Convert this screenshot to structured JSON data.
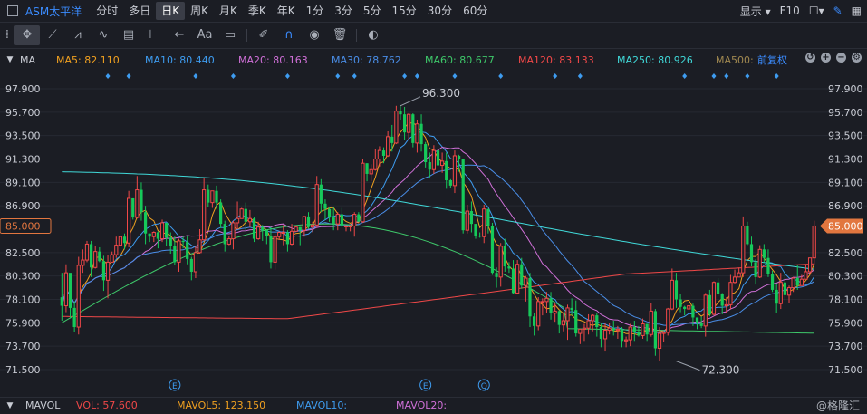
{
  "topbar": {
    "symbol": "ASM太平洋",
    "periods": [
      "分时",
      "多日",
      "日K",
      "周K",
      "月K",
      "季K",
      "年K",
      "1分",
      "3分",
      "5分",
      "15分",
      "30分",
      "60分"
    ],
    "active_period": "日K",
    "display_label": "显示",
    "f10_label": "F10"
  },
  "toolbar": {
    "text_tool": "Aa"
  },
  "legend": {
    "title": "MA",
    "items": [
      {
        "text": "MA5: 82.110",
        "color": "#f0a020"
      },
      {
        "text": "MA10: 80.440",
        "color": "#3e9cf0"
      },
      {
        "text": "MA20: 80.163",
        "color": "#d070d8"
      },
      {
        "text": "MA30: 78.762",
        "color": "#4a8ee8"
      },
      {
        "text": "MA60: 80.677",
        "color": "#3ec86a"
      },
      {
        "text": "MA120: 83.133",
        "color": "#f04848"
      },
      {
        "text": "MA250: 80.926",
        "color": "#40d8d8"
      },
      {
        "text": "MA500: ",
        "color": "#a08850"
      }
    ],
    "adjust_label": "前复权"
  },
  "bottom": {
    "title": "MAVOL",
    "items": [
      {
        "text": "VOL: 57.600",
        "color": "#f04848"
      },
      {
        "text": "MAVOL5: 123.150",
        "color": "#f0a020"
      },
      {
        "text": "MAVOL10: ",
        "color": "#3e9cf0"
      },
      {
        "text": "MAVOL20: ",
        "color": "#d070d8"
      }
    ],
    "watermark": "@格隆汇"
  },
  "chart_data": {
    "type": "candlestick",
    "y_ticks": [
      "97.900",
      "95.700",
      "93.500",
      "91.300",
      "89.100",
      "86.900",
      "85.000",
      "82.500",
      "80.300",
      "78.100",
      "75.900",
      "73.700",
      "71.500"
    ],
    "y_tick_values": [
      97.9,
      95.7,
      93.5,
      91.3,
      89.1,
      86.9,
      85.0,
      82.5,
      80.3,
      78.1,
      75.9,
      73.7,
      71.5
    ],
    "current_price_label": "85.000",
    "current_price": 85.0,
    "high_annotation": {
      "label": "96.300",
      "value": 96.3,
      "index": 81
    },
    "low_annotation": {
      "label": "72.300",
      "value": 72.3,
      "index": 147
    },
    "event_markers": [
      {
        "label": "E",
        "index": 27
      },
      {
        "label": "E",
        "index": 87
      },
      {
        "label": "Q",
        "index": 101
      }
    ],
    "colors": {
      "up": "#f04848",
      "down": "#16c95a",
      "price_line": "#e2763f"
    },
    "candles": [
      [
        78.3,
        77.5,
        80.6,
        76.1
      ],
      [
        77.5,
        80.6,
        81.4,
        76.9
      ],
      [
        80.6,
        77.3,
        80.3,
        76.3
      ],
      [
        77.3,
        75.5,
        77.9,
        75.0
      ],
      [
        75.5,
        81.3,
        82.1,
        74.8
      ],
      [
        81.3,
        81.8,
        82.8,
        80.6
      ],
      [
        81.8,
        83.3,
        83.6,
        81.6
      ],
      [
        83.3,
        81.1,
        83.6,
        80.2
      ],
      [
        81.1,
        82.6,
        83.1,
        81.0
      ],
      [
        82.6,
        81.7,
        83.0,
        81.6
      ],
      [
        81.7,
        79.9,
        82.2,
        78.9
      ],
      [
        79.9,
        81.6,
        82.3,
        78.2
      ],
      [
        81.6,
        82.3,
        82.6,
        81.6
      ],
      [
        82.3,
        83.2,
        84.0,
        82.0
      ],
      [
        83.2,
        84.0,
        84.1,
        83.1
      ],
      [
        84.0,
        83.4,
        84.3,
        82.8
      ],
      [
        83.4,
        87.6,
        88.3,
        83.0
      ],
      [
        87.6,
        85.8,
        87.6,
        85.6
      ],
      [
        85.8,
        88.4,
        89.7,
        85.7
      ],
      [
        88.4,
        86.3,
        89.1,
        85.5
      ],
      [
        86.3,
        84.3,
        86.9,
        83.3
      ],
      [
        84.3,
        84.0,
        84.3,
        83.5
      ],
      [
        84.0,
        84.4,
        84.5,
        83.5
      ],
      [
        84.4,
        83.8,
        84.5,
        82.9
      ],
      [
        83.8,
        85.3,
        85.6,
        83.5
      ],
      [
        85.3,
        83.9,
        85.3,
        83.1
      ],
      [
        83.9,
        83.1,
        84.4,
        82.4
      ],
      [
        83.1,
        81.6,
        84.0,
        81.3
      ],
      [
        81.6,
        83.6,
        83.8,
        80.7
      ],
      [
        83.6,
        83.5,
        84.0,
        82.9
      ],
      [
        83.5,
        81.9,
        84.1,
        81.4
      ],
      [
        81.9,
        80.7,
        82.1,
        79.9
      ],
      [
        80.7,
        82.5,
        83.1,
        80.1
      ],
      [
        82.5,
        83.7,
        84.7,
        82.4
      ],
      [
        83.7,
        88.4,
        89.5,
        83.6
      ],
      [
        88.4,
        87.2,
        88.9,
        86.8
      ],
      [
        87.2,
        88.3,
        88.3,
        86.7
      ],
      [
        88.3,
        87.2,
        88.8,
        86.6
      ],
      [
        87.2,
        85.2,
        87.5,
        84.8
      ],
      [
        85.2,
        83.3,
        85.5,
        82.6
      ],
      [
        83.3,
        83.8,
        84.1,
        83.2
      ],
      [
        83.8,
        85.3,
        85.5,
        82.8
      ],
      [
        85.3,
        85.7,
        87.3,
        84.7
      ],
      [
        85.7,
        86.6,
        86.7,
        85.7
      ],
      [
        86.6,
        85.4,
        87.2,
        84.6
      ],
      [
        85.4,
        85.7,
        86.5,
        84.9
      ],
      [
        85.7,
        83.8,
        85.8,
        83.5
      ],
      [
        83.8,
        84.9,
        85.4,
        83.7
      ],
      [
        84.9,
        84.6,
        85.1,
        83.6
      ],
      [
        84.6,
        84.1,
        84.7,
        83.3
      ],
      [
        84.1,
        81.6,
        84.9,
        81.0
      ],
      [
        81.6,
        84.0,
        84.3,
        80.9
      ],
      [
        84.0,
        84.4,
        84.5,
        83.7
      ],
      [
        84.4,
        84.4,
        85.1,
        83.2
      ],
      [
        84.4,
        83.3,
        84.6,
        82.6
      ],
      [
        83.3,
        84.5,
        85.2,
        83.2
      ],
      [
        84.5,
        84.9,
        85.0,
        84.8
      ],
      [
        84.9,
        84.6,
        84.9,
        83.2
      ],
      [
        84.6,
        85.9,
        85.9,
        84.0
      ],
      [
        85.9,
        84.9,
        86.3,
        84.7
      ],
      [
        84.9,
        85.1,
        85.4,
        84.4
      ],
      [
        85.1,
        88.9,
        89.7,
        84.9
      ],
      [
        88.9,
        87.1,
        89.4,
        86.3
      ],
      [
        87.1,
        86.6,
        87.5,
        85.6
      ],
      [
        86.6,
        85.8,
        86.8,
        85.4
      ],
      [
        85.8,
        85.2,
        86.8,
        84.6
      ],
      [
        85.2,
        86.1,
        86.3,
        84.6
      ],
      [
        86.1,
        85.0,
        86.7,
        84.9
      ],
      [
        85.0,
        85.0,
        85.0,
        84.5
      ],
      [
        85.0,
        85.0,
        85.1,
        84.5
      ],
      [
        85.0,
        86.1,
        86.3,
        84.0
      ],
      [
        86.1,
        85.4,
        86.3,
        85.4
      ],
      [
        85.4,
        90.9,
        91.3,
        85.3
      ],
      [
        90.9,
        89.9,
        90.9,
        89.2
      ],
      [
        89.9,
        90.3,
        90.8,
        89.2
      ],
      [
        90.3,
        91.3,
        92.2,
        90.2
      ],
      [
        91.3,
        92.1,
        92.5,
        90.6
      ],
      [
        92.1,
        91.6,
        92.4,
        90.9
      ],
      [
        91.6,
        93.4,
        93.9,
        91.5
      ],
      [
        93.4,
        92.8,
        94.5,
        92.0
      ],
      [
        92.8,
        95.8,
        96.3,
        92.7
      ],
      [
        95.8,
        95.5,
        96.3,
        95.0
      ],
      [
        95.5,
        93.8,
        96.2,
        93.1
      ],
      [
        93.8,
        95.5,
        95.6,
        93.1
      ],
      [
        95.5,
        92.8,
        95.6,
        92.4
      ],
      [
        92.8,
        94.6,
        95.0,
        91.9
      ],
      [
        94.6,
        92.7,
        95.5,
        92.0
      ],
      [
        92.7,
        91.0,
        92.9,
        90.5
      ],
      [
        91.0,
        90.3,
        91.9,
        89.5
      ],
      [
        90.3,
        92.1,
        92.6,
        89.9
      ],
      [
        92.1,
        90.7,
        92.6,
        89.9
      ],
      [
        90.7,
        91.1,
        91.9,
        90.0
      ],
      [
        91.1,
        89.3,
        91.9,
        88.5
      ],
      [
        89.3,
        88.8,
        89.4,
        88.6
      ],
      [
        88.8,
        91.6,
        92.1,
        88.1
      ],
      [
        91.6,
        91.3,
        91.7,
        90.1
      ],
      [
        91.3,
        84.6,
        91.3,
        84.3
      ],
      [
        84.6,
        86.4,
        87.0,
        84.3
      ],
      [
        86.4,
        85.2,
        87.3,
        84.4
      ],
      [
        85.2,
        84.1,
        85.2,
        83.8
      ],
      [
        84.1,
        84.0,
        84.4,
        83.9
      ],
      [
        84.0,
        86.6,
        87.0,
        83.4
      ],
      [
        86.6,
        85.0,
        86.6,
        84.3
      ],
      [
        85.0,
        80.6,
        85.3,
        80.4
      ],
      [
        80.6,
        80.2,
        81.1,
        79.2
      ],
      [
        80.2,
        83.1,
        83.4,
        79.3
      ],
      [
        83.1,
        81.2,
        83.8,
        80.7
      ],
      [
        81.2,
        81.0,
        81.6,
        80.6
      ],
      [
        81.0,
        78.7,
        81.8,
        78.6
      ],
      [
        78.7,
        81.4,
        81.8,
        78.6
      ],
      [
        81.4,
        79.4,
        82.0,
        79.1
      ],
      [
        79.4,
        80.1,
        80.3,
        77.9
      ],
      [
        80.1,
        76.5,
        80.6,
        75.5
      ],
      [
        76.5,
        75.6,
        76.8,
        74.7
      ],
      [
        75.6,
        77.9,
        78.3,
        75.2
      ],
      [
        77.9,
        77.9,
        78.2,
        76.6
      ],
      [
        77.9,
        78.2,
        78.8,
        76.8
      ],
      [
        78.2,
        76.8,
        78.8,
        76.2
      ],
      [
        76.8,
        77.0,
        77.8,
        76.0
      ],
      [
        77.0,
        75.7,
        77.1,
        74.9
      ],
      [
        75.7,
        76.1,
        76.9,
        75.1
      ],
      [
        76.1,
        77.3,
        77.6,
        74.3
      ],
      [
        77.3,
        77.1,
        78.2,
        76.6
      ],
      [
        77.1,
        74.9,
        78.0,
        74.6
      ],
      [
        74.9,
        75.3,
        75.3,
        73.9
      ],
      [
        75.3,
        75.4,
        75.8,
        74.2
      ],
      [
        75.4,
        76.1,
        76.7,
        74.8
      ],
      [
        76.1,
        76.6,
        76.7,
        75.1
      ],
      [
        76.6,
        75.5,
        76.8,
        74.6
      ],
      [
        75.5,
        74.4,
        75.9,
        73.6
      ],
      [
        74.4,
        75.2,
        75.9,
        73.2
      ],
      [
        75.2,
        75.4,
        75.9,
        74.8
      ],
      [
        75.4,
        75.2,
        76.1,
        74.7
      ],
      [
        75.2,
        75.3,
        75.6,
        74.4
      ],
      [
        75.3,
        74.2,
        75.5,
        73.6
      ],
      [
        74.2,
        74.3,
        74.6,
        73.6
      ],
      [
        74.3,
        75.5,
        75.8,
        73.7
      ],
      [
        75.5,
        75.0,
        76.1,
        74.2
      ],
      [
        75.0,
        74.7,
        75.6,
        74.6
      ],
      [
        74.7,
        75.8,
        76.3,
        74.4
      ],
      [
        75.8,
        74.8,
        75.8,
        74.2
      ],
      [
        74.8,
        77.0,
        77.8,
        74.6
      ],
      [
        77.0,
        73.5,
        77.2,
        72.8
      ],
      [
        73.5,
        74.9,
        75.5,
        72.3
      ],
      [
        74.9,
        75.0,
        75.1,
        74.1
      ],
      [
        75.0,
        77.2,
        77.3,
        74.7
      ],
      [
        77.2,
        79.9,
        81.0,
        77.1
      ],
      [
        79.9,
        78.1,
        80.6,
        77.3
      ],
      [
        78.1,
        77.4,
        78.6,
        76.9
      ],
      [
        77.4,
        77.2,
        77.5,
        76.6
      ],
      [
        77.2,
        77.5,
        77.5,
        77.4
      ],
      [
        77.5,
        76.4,
        77.7,
        75.6
      ],
      [
        76.4,
        75.9,
        76.4,
        75.3
      ],
      [
        75.9,
        75.6,
        76.5,
        75.4
      ],
      [
        75.6,
        78.5,
        78.7,
        74.6
      ],
      [
        78.5,
        76.7,
        79.0,
        76.5
      ],
      [
        76.7,
        79.7,
        79.8,
        76.6
      ],
      [
        79.7,
        78.6,
        80.1,
        78.4
      ],
      [
        78.6,
        77.5,
        78.7,
        76.7
      ],
      [
        77.5,
        77.6,
        78.3,
        76.8
      ],
      [
        77.6,
        79.7,
        80.4,
        77.2
      ],
      [
        79.7,
        80.2,
        80.9,
        79.6
      ],
      [
        80.2,
        80.6,
        81.1,
        80.2
      ],
      [
        80.6,
        85.0,
        85.9,
        80.2
      ],
      [
        85.0,
        83.3,
        85.4,
        83.2
      ],
      [
        83.3,
        81.6,
        84.0,
        81.2
      ],
      [
        81.6,
        80.2,
        81.9,
        79.5
      ],
      [
        80.2,
        82.8,
        83.2,
        80.1
      ],
      [
        82.8,
        82.0,
        83.3,
        81.6
      ],
      [
        82.0,
        80.5,
        82.8,
        80.2
      ],
      [
        80.5,
        79.0,
        80.8,
        78.8
      ],
      [
        79.0,
        77.7,
        79.6,
        76.8
      ],
      [
        77.7,
        79.7,
        80.6,
        77.2
      ],
      [
        79.7,
        78.5,
        80.7,
        78.0
      ],
      [
        78.5,
        79.2,
        79.4,
        77.8
      ],
      [
        79.2,
        80.1,
        80.2,
        78.8
      ],
      [
        80.1,
        79.4,
        81.3,
        79.0
      ],
      [
        79.4,
        80.0,
        80.4,
        79.4
      ],
      [
        80.0,
        80.7,
        81.3,
        80.0
      ],
      [
        80.7,
        82.0,
        82.0,
        80.5
      ],
      [
        82.0,
        85.0,
        85.5,
        81.3
      ]
    ]
  }
}
